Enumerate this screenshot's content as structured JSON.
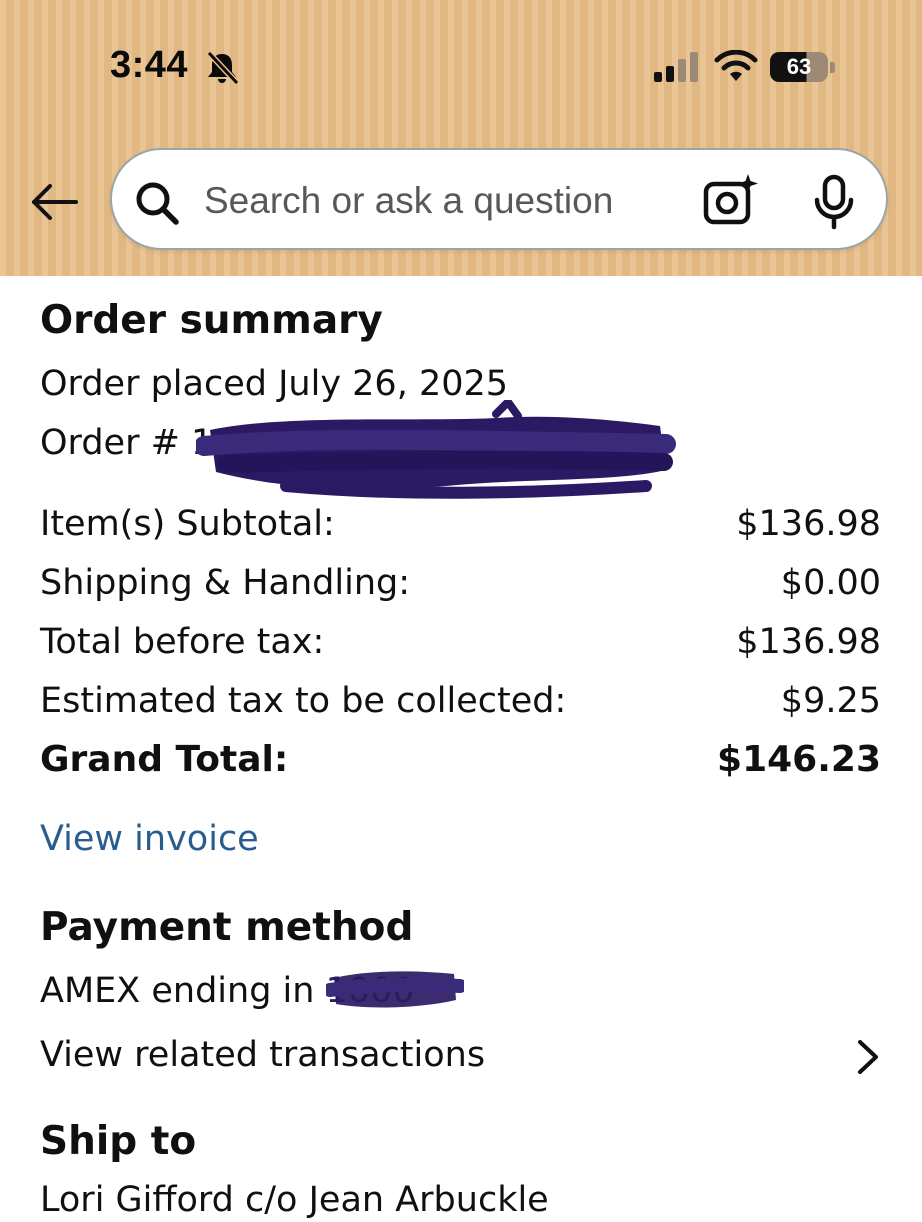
{
  "status_bar": {
    "time": "3:44",
    "battery": "63"
  },
  "search": {
    "placeholder": "Search or ask a question"
  },
  "order_summary": {
    "heading": "Order summary",
    "placed": "Order placed July 26, 2025",
    "order_number_label": "Order # 1",
    "lines": [
      {
        "label": "Item(s) Subtotal:",
        "value": "$136.98"
      },
      {
        "label": "Shipping & Handling:",
        "value": "$0.00"
      },
      {
        "label": "Total before tax:",
        "value": "$136.98"
      },
      {
        "label": "Estimated tax to be collected:",
        "value": "$9.25"
      }
    ],
    "grand_total": {
      "label": "Grand Total:",
      "value": "$146.23"
    },
    "view_invoice": "View invoice"
  },
  "payment": {
    "heading": "Payment method",
    "card_text": "AMEX ending in",
    "card_last4": "1000",
    "view_transactions": "View related transactions"
  },
  "ship_to": {
    "heading": "Ship to",
    "name": "Lori Gifford c/o Jean Arbuckle"
  },
  "icons": {
    "back": "back-arrow-icon",
    "search": "search-icon",
    "camera": "camera-icon",
    "mic": "microphone-icon",
    "bell": "bell-slash-icon",
    "signal": "cellular-signal-icon",
    "wifi": "wifi-icon",
    "chevron": "chevron-right-icon"
  },
  "colors": {
    "header_bg": "#e7bd88",
    "link": "#2a5d8f",
    "redaction": "#2b1a63"
  }
}
